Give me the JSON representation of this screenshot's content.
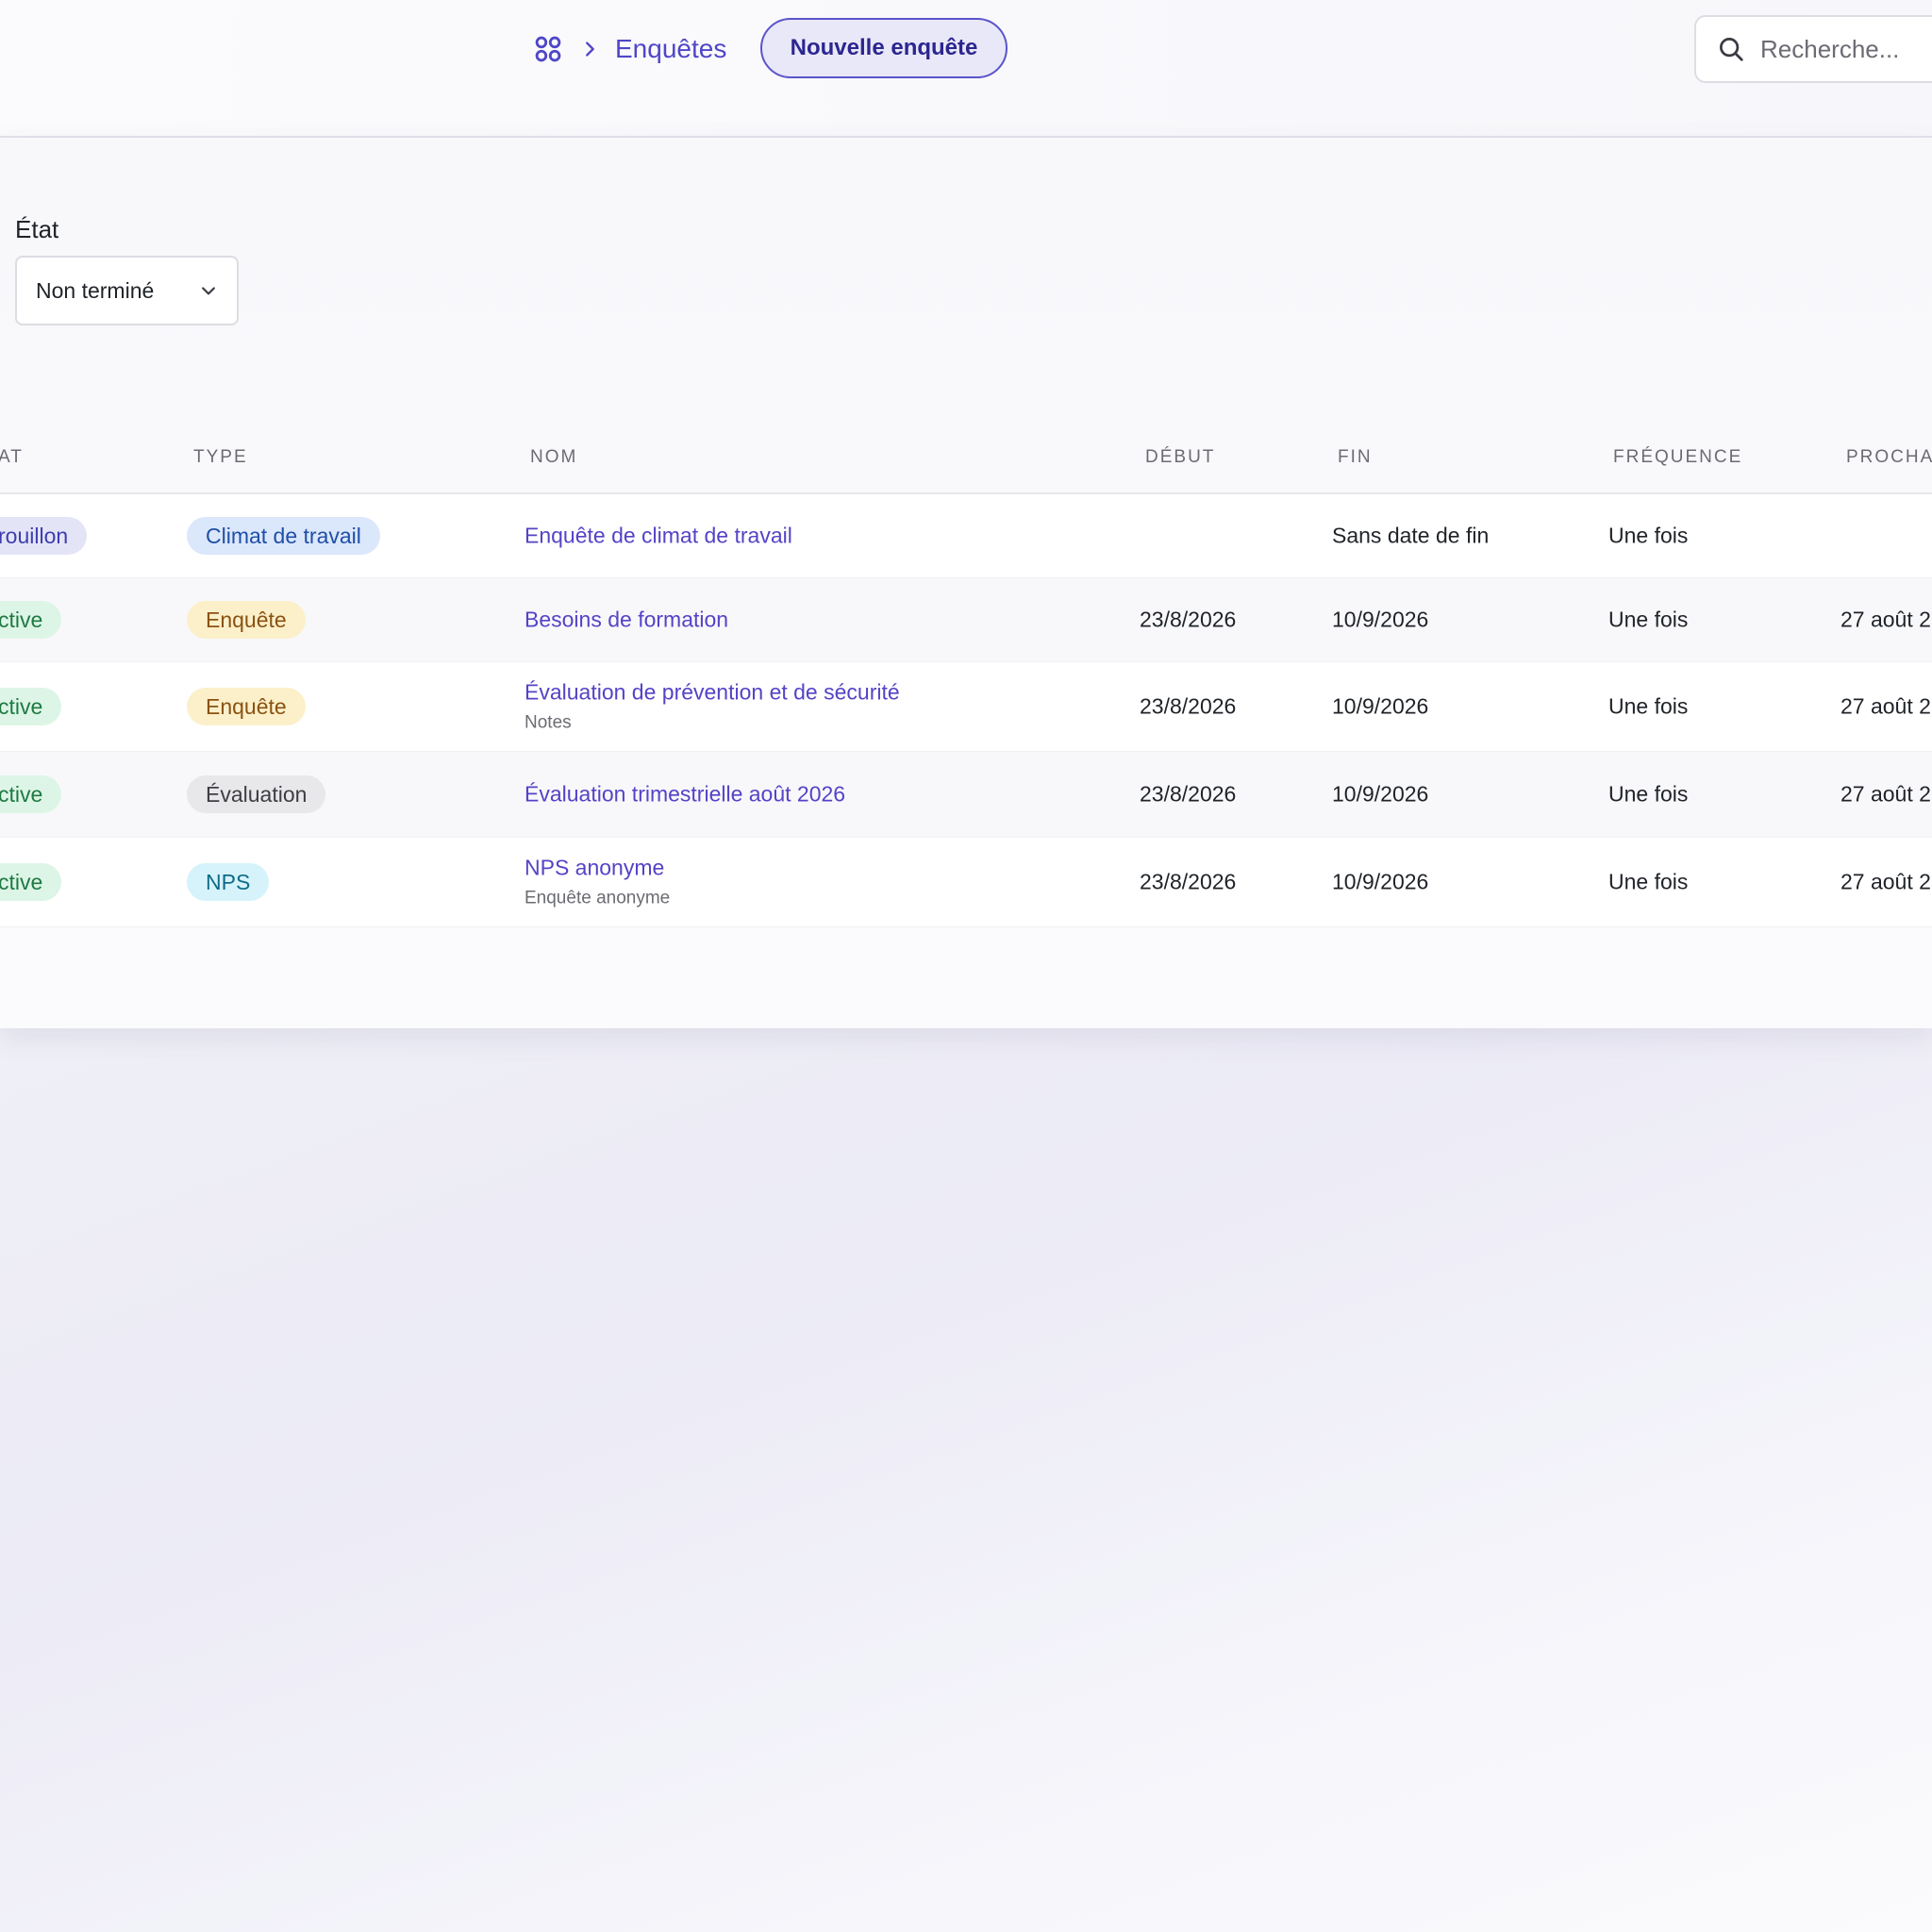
{
  "header": {
    "breadcrumb": {
      "home_icon": "grid-icon",
      "separator_icon": "chevron-right-icon",
      "current": "Enquêtes"
    },
    "new_button_label": "Nouvelle enquête",
    "search": {
      "icon": "search-icon",
      "placeholder": "Recherche..."
    }
  },
  "filter": {
    "label": "État",
    "selected": "Non terminé",
    "icon": "chevron-down-icon"
  },
  "table": {
    "columns": [
      "AT",
      "TYPE",
      "NOM",
      "DÉBUT",
      "FIN",
      "FRÉQUENCE",
      "PROCHA"
    ],
    "rows": [
      {
        "state": "rouillon",
        "state_color": "#e4e4f7",
        "state_text_color": "#3d3db0",
        "type": "Climat de travail",
        "type_color": "#dbe7fb",
        "type_text_color": "#1f4fa8",
        "name": "Enquête de climat de travail",
        "sub": "",
        "start": "",
        "end": "Sans date de fin",
        "frequency": "Une fois",
        "next": ""
      },
      {
        "state": "ctive",
        "state_color": "#ddf5e6",
        "state_text_color": "#1e7a43",
        "type": "Enquête",
        "type_color": "#fbf0c9",
        "type_text_color": "#8a5212",
        "name": "Besoins de formation",
        "sub": "",
        "start": "23/8/2026",
        "end": "10/9/2026",
        "frequency": "Une fois",
        "next": "27 août 2"
      },
      {
        "state": "ctive",
        "state_color": "#ddf5e6",
        "state_text_color": "#1e7a43",
        "type": "Enquête",
        "type_color": "#fbf0c9",
        "type_text_color": "#8a5212",
        "name": "Évaluation de prévention et de sécurité",
        "sub": "Notes",
        "start": "23/8/2026",
        "end": "10/9/2026",
        "frequency": "Une fois",
        "next": "27 août 2"
      },
      {
        "state": "ctive",
        "state_color": "#ddf5e6",
        "state_text_color": "#1e7a43",
        "type": "Évaluation",
        "type_color": "#e8e8ea",
        "type_text_color": "#3d3d44",
        "name": "Évaluation trimestrielle août 2026",
        "sub": "",
        "start": "23/8/2026",
        "end": "10/9/2026",
        "frequency": "Une fois",
        "next": "27 août 2"
      },
      {
        "state": "ctive",
        "state_color": "#ddf5e6",
        "state_text_color": "#1e7a43",
        "type": "NPS",
        "type_color": "#d6f3fb",
        "type_text_color": "#0f6c88",
        "name": "NPS anonyme",
        "sub": "Enquête anonyme",
        "start": "23/8/2026",
        "end": "10/9/2026",
        "frequency": "Une fois",
        "next": "27 août 2"
      }
    ]
  }
}
